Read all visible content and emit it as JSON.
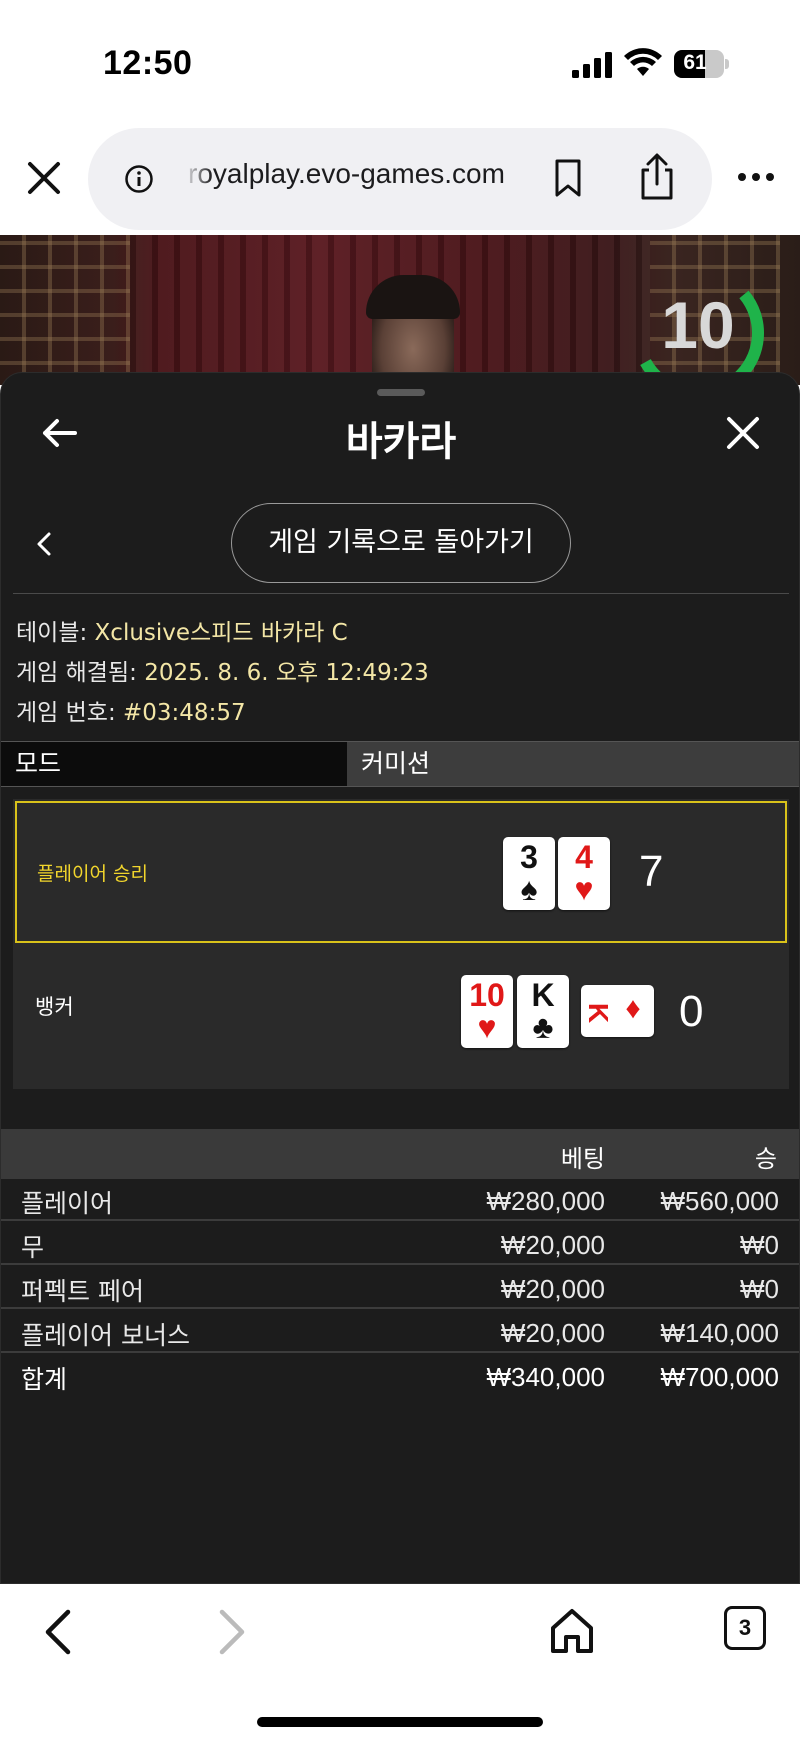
{
  "status_bar": {
    "time": "12:50",
    "battery_level": "61",
    "battery_fraction": 0.61,
    "icons": [
      "signal-icon",
      "wifi-icon",
      "battery-icon"
    ]
  },
  "browser": {
    "url": "royalplay.evo-games.com",
    "icons": [
      "close-icon",
      "info-icon",
      "bookmark-icon",
      "share-icon",
      "more-icon"
    ]
  },
  "video": {
    "countdown": "10",
    "countdown_color": "#1fb34a"
  },
  "sheet": {
    "title": "바카라",
    "back_to_history": "게임 기록으로 돌아가기",
    "info": {
      "table_label": "테이블:",
      "table_value": "Xclusive스피드 바카라 C",
      "resolved_label": "게임 해결됨:",
      "resolved_value": "2025. 8. 6. 오후 12:49:23",
      "number_label": "게임 번호:",
      "number_value": "#03:48:57"
    },
    "mode_label": "모드",
    "commission_label": "커미션",
    "result": {
      "player_label": "플레이어 승리",
      "player_score": "7",
      "player_cards": [
        {
          "rank": "3",
          "suit": "♠",
          "color": "black"
        },
        {
          "rank": "4",
          "suit": "♥",
          "color": "red"
        }
      ],
      "banker_label": "뱅커",
      "banker_score": "0",
      "banker_cards": [
        {
          "rank": "10",
          "suit": "♥",
          "color": "red"
        },
        {
          "rank": "K",
          "suit": "♣",
          "color": "black"
        },
        {
          "rank": "K",
          "suit": "♦",
          "color": "red"
        }
      ],
      "highlight_color": "#d9c21a"
    },
    "bets": {
      "header_bet": "베팅",
      "header_win": "승",
      "rows": [
        {
          "name": "플레이어",
          "bet": "₩280,000",
          "win": "₩560,000"
        },
        {
          "name": "무",
          "bet": "₩20,000",
          "win": "₩0"
        },
        {
          "name": "퍼펙트 페어",
          "bet": "₩20,000",
          "win": "₩0"
        },
        {
          "name": "플레이어 보너스",
          "bet": "₩20,000",
          "win": "₩140,000"
        }
      ],
      "total": {
        "name": "합계",
        "bet": "₩340,000",
        "win": "₩700,000"
      }
    }
  },
  "bottom_bar": {
    "tab_count": "3",
    "icons": [
      "back-icon",
      "forward-icon",
      "home-icon",
      "tabs-icon"
    ]
  }
}
